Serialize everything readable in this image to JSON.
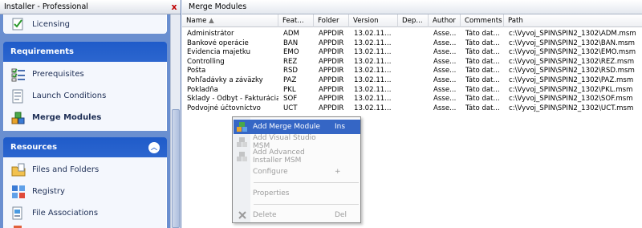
{
  "left": {
    "title": "Installer - Professional",
    "close": "x",
    "top_item": "Licensing",
    "groups": [
      {
        "title": "Requirements",
        "items": [
          "Prerequisites",
          "Launch Conditions",
          "Merge Modules"
        ]
      },
      {
        "title": "Resources",
        "items": [
          "Files and Folders",
          "Registry",
          "File Associations"
        ]
      }
    ]
  },
  "right": {
    "title": "Merge Modules",
    "columns": [
      "Name",
      "Feat...",
      "Folder",
      "Version",
      "Dep...",
      "Author",
      "Comments",
      "Path"
    ],
    "rows": [
      [
        "Administrátor",
        "ADM",
        "APPDIR",
        "13.02.11...",
        "",
        "Asse...",
        "Táto dat...",
        "c:\\Vyvoj_SPIN\\SPIN2_1302\\ADM.msm"
      ],
      [
        "Bankové operácie",
        "BAN",
        "APPDIR",
        "13.02.11...",
        "",
        "Asse...",
        "Táto dat...",
        "c:\\Vyvoj_SPIN\\SPIN2_1302\\BAN.msm"
      ],
      [
        "Evidencia majetku",
        "EMO",
        "APPDIR",
        "13.02.11...",
        "",
        "Asse...",
        "Táto dat...",
        "c:\\Vyvoj_SPIN\\SPIN2_1302\\EMO.msm"
      ],
      [
        "Controlling",
        "REZ",
        "APPDIR",
        "13.02.11...",
        "",
        "Asse...",
        "Táto dat...",
        "c:\\Vyvoj_SPIN\\SPIN2_1302\\REZ.msm"
      ],
      [
        "Pošta",
        "RSD",
        "APPDIR",
        "13.02.11...",
        "",
        "Asse...",
        "Táto dat...",
        "c:\\Vyvoj_SPIN\\SPIN2_1302\\RSD.msm"
      ],
      [
        "Pohľadávky a záväzky",
        "PAZ",
        "APPDIR",
        "13.02.11...",
        "",
        "Asse...",
        "Táto dat...",
        "c:\\Vyvoj_SPIN\\SPIN2_1302\\PAZ.msm"
      ],
      [
        "Pokladňa",
        "PKL",
        "APPDIR",
        "13.02.11...",
        "",
        "Asse...",
        "Táto dat...",
        "c:\\Vyvoj_SPIN\\SPIN2_1302\\PKL.msm"
      ],
      [
        "Sklady - Odbyt - Fakturácia",
        "SOF",
        "APPDIR",
        "13.02.11...",
        "",
        "Asse...",
        "Táto dat...",
        "c:\\Vyvoj_SPIN\\SPIN2_1302\\SOF.msm"
      ],
      [
        "Podvojné účtovníctvo",
        "UCT",
        "APPDIR",
        "13.02.11...",
        "",
        "Asse...",
        "Táto dat...",
        "c:\\Vyvoj_SPIN\\SPIN2_1302\\UCT.msm"
      ]
    ]
  },
  "menu": {
    "items": [
      {
        "label": "Add Merge Module",
        "key": "Ins",
        "icon": "merge-module-icon",
        "active": true
      },
      {
        "label": "Add Visual Studio MSM",
        "key": "",
        "icon": "vs-msm-icon"
      },
      {
        "label": "Add Advanced Installer MSM",
        "key": "",
        "icon": "ai-msm-icon"
      },
      {
        "label": "Configure",
        "key": "+",
        "icon": ""
      },
      {
        "label": "Properties",
        "key": "",
        "icon": ""
      },
      {
        "label": "Delete",
        "key": "Del",
        "icon": "delete-icon"
      }
    ]
  },
  "colors": {
    "accent": "#2c66cf",
    "menu_highlight": "#3566c5",
    "sidebar_bg": "#6a8fd0"
  }
}
